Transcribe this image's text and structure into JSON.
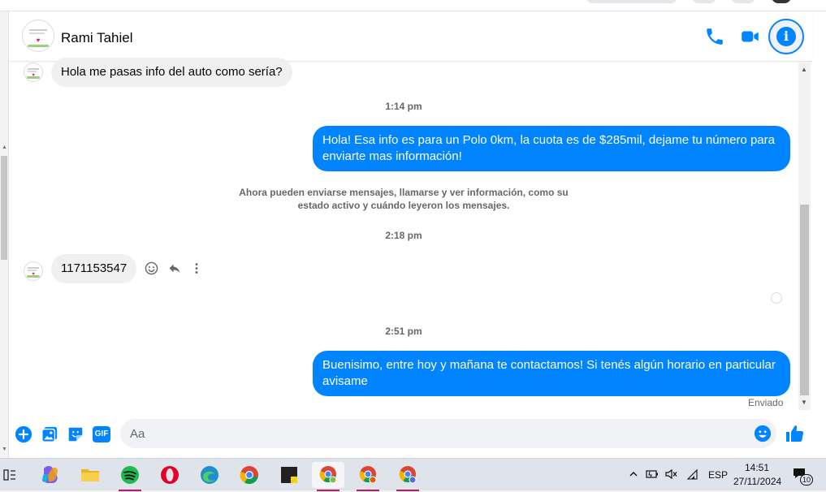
{
  "header": {
    "contact_name": "Rami Tahiel"
  },
  "messages": {
    "m1": "Hola me pasas info del auto como sería?",
    "t1": "1:14 pm",
    "m2": "Hola! Esa info es para un Polo 0km, la cuota es de $285mil, dejame tu número para enviarte mas información!",
    "notice": "Ahora pueden enviarse mensajes, llamarse y ver información, como su estado activo y cuándo leyeron los mensajes.",
    "t2": "2:18 pm",
    "m3": "1171153547",
    "t3": "2:51 pm",
    "m4": "Buenisimo, entre hoy y mañana te contactamos! Si tenés algún horario en particular avisame",
    "status": "Enviado"
  },
  "composer": {
    "placeholder": "Aa",
    "gif_label": "GIF"
  },
  "taskbar": {
    "lang": "ESP",
    "time": "14:51",
    "date": "27/11/2024",
    "notif_count": "10"
  },
  "colors": {
    "accent": "#0084ff",
    "bubble_in": "#f0f0f0"
  }
}
